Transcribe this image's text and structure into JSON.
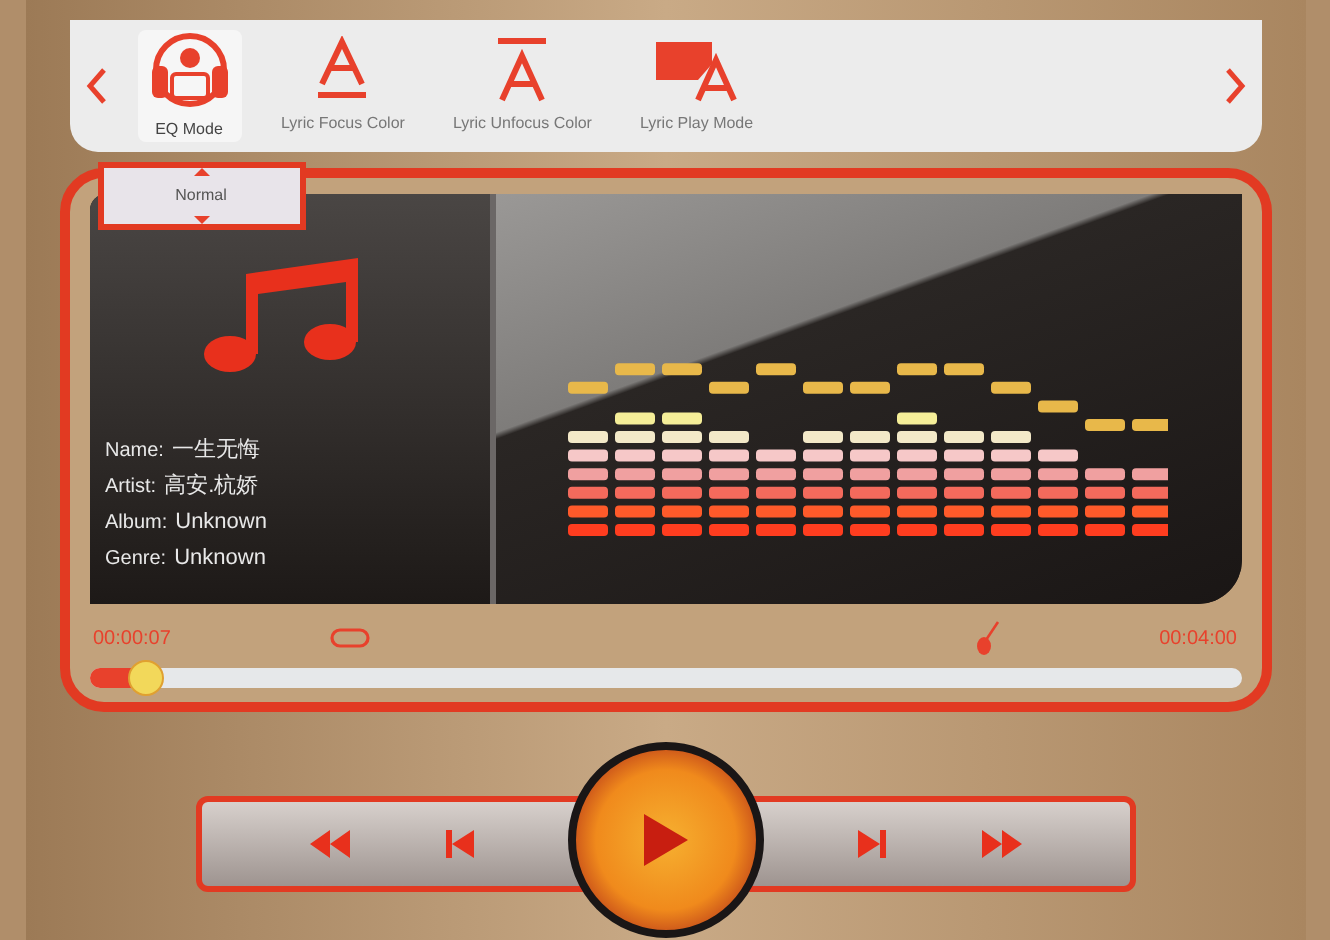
{
  "toolbar": {
    "items": [
      {
        "kind": "eq",
        "label": "EQ Mode",
        "selected": true
      },
      {
        "kind": "focus",
        "label": "Lyric Focus Color",
        "selected": false
      },
      {
        "kind": "unfocus",
        "label": "Lyric Unfocus Color",
        "selected": false
      },
      {
        "kind": "play",
        "label": "Lyric Play Mode",
        "selected": false
      }
    ]
  },
  "eq_dropdown": {
    "value": "Normal"
  },
  "track": {
    "fields": [
      {
        "label": "Name:",
        "value": "一生无悔"
      },
      {
        "label": "Artist:",
        "value": "高安.杭娇"
      },
      {
        "label": "Album:",
        "value": "Unknown"
      },
      {
        "label": "Genre:",
        "value": "Unknown"
      }
    ]
  },
  "playback": {
    "elapsed": "00:00:07",
    "total": "00:04:00",
    "progress": {
      "level": 0.05
    }
  }
}
